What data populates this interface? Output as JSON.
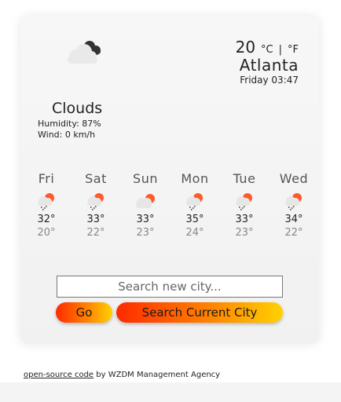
{
  "current": {
    "condition": "Clouds",
    "icon": "clouds-icon",
    "temperature": "20",
    "unit_c": "°C",
    "unit_separator": "|",
    "unit_f": "°F",
    "city": "Atlanta",
    "datetime": "Friday 03:47",
    "humidity": "Humidity: 87%",
    "wind": "Wind: 0 km/h"
  },
  "forecast": [
    {
      "day": "Fri",
      "icon": "rain-sun-icon",
      "high": "32°",
      "low": "20°"
    },
    {
      "day": "Sat",
      "icon": "rain-sun-icon",
      "high": "33°",
      "low": "22°"
    },
    {
      "day": "Sun",
      "icon": "cloud-sun-icon",
      "high": "33°",
      "low": "23°"
    },
    {
      "day": "Mon",
      "icon": "rain-sun-icon",
      "high": "35°",
      "low": "24°"
    },
    {
      "day": "Tue",
      "icon": "rain-sun-icon",
      "high": "33°",
      "low": "23°"
    },
    {
      "day": "Wed",
      "icon": "rain-sun-icon",
      "high": "34°",
      "low": "22°"
    }
  ],
  "search": {
    "placeholder": "Search new city...",
    "value": "",
    "go_label": "Go",
    "current_label": "Search Current City"
  },
  "footer": {
    "link_text": "open-source code",
    "credit": " by WZDM Management Agency"
  },
  "colors": {
    "button_gradient_start": "#ff2a00",
    "button_gradient_mid": "#ff8a00",
    "button_gradient_end": "#ffd200",
    "sun": "#ff5a2a"
  }
}
